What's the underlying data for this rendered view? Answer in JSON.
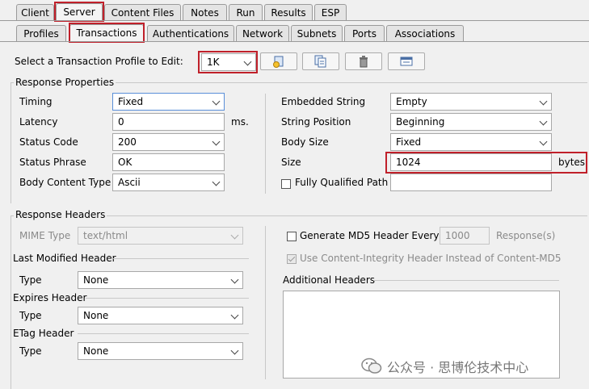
{
  "top_tabs": [
    "Client",
    "Server",
    "Content Files",
    "Notes",
    "Run",
    "Results",
    "ESP"
  ],
  "sub_tabs": [
    "Profiles",
    "Transactions",
    "Authentications",
    "Network",
    "Subnets",
    "Ports",
    "Associations"
  ],
  "profile": {
    "label": "Select a Transaction Profile to Edit:",
    "value": "1K",
    "toolbar_icons": [
      "add-profile-icon",
      "copy-profile-icon",
      "delete-profile-icon",
      "rename-profile-icon"
    ]
  },
  "response_properties": {
    "title": "Response Properties",
    "timing_label": "Timing",
    "timing_value": "Fixed",
    "latency_label": "Latency",
    "latency_value": "0",
    "latency_unit": "ms.",
    "status_code_label": "Status Code",
    "status_code_value": "200",
    "status_phrase_label": "Status Phrase",
    "status_phrase_value": "OK",
    "body_content_type_label": "Body Content Type",
    "body_content_type_value": "Ascii",
    "embedded_string_label": "Embedded String",
    "embedded_string_value": "Empty",
    "string_position_label": "String Position",
    "string_position_value": "Beginning",
    "body_size_label": "Body Size",
    "body_size_value": "Fixed",
    "size_label": "Size",
    "size_value": "1024",
    "size_unit": "bytes",
    "fqp_label": "Fully Qualified Path",
    "fqp_checked": false,
    "fqp_value": ""
  },
  "response_headers": {
    "title": "Response Headers",
    "mime_label": "MIME Type",
    "mime_value": "text/html",
    "last_modified_title": "Last Modified Header",
    "last_modified_type_label": "Type",
    "last_modified_type_value": "None",
    "expires_title": "Expires Header",
    "expires_type_label": "Type",
    "expires_type_value": "None",
    "etag_title": "ETag Header",
    "etag_type_label": "Type",
    "etag_type_value": "None",
    "md5_label": "Generate MD5 Header Every",
    "md5_checked": false,
    "md5_value": "1000",
    "md5_unit": "Response(s)",
    "content_integrity_label": "Use Content-Integrity Header Instead of Content-MD5",
    "content_integrity_checked": true,
    "additional_headers_title": "Additional Headers",
    "additional_headers_value": ""
  },
  "watermark": "公众号 · 思博伦技术中心",
  "colors": {
    "highlight": "#c0202a",
    "focus_border": "#5a8fd8",
    "background": "#f0f0f0"
  }
}
